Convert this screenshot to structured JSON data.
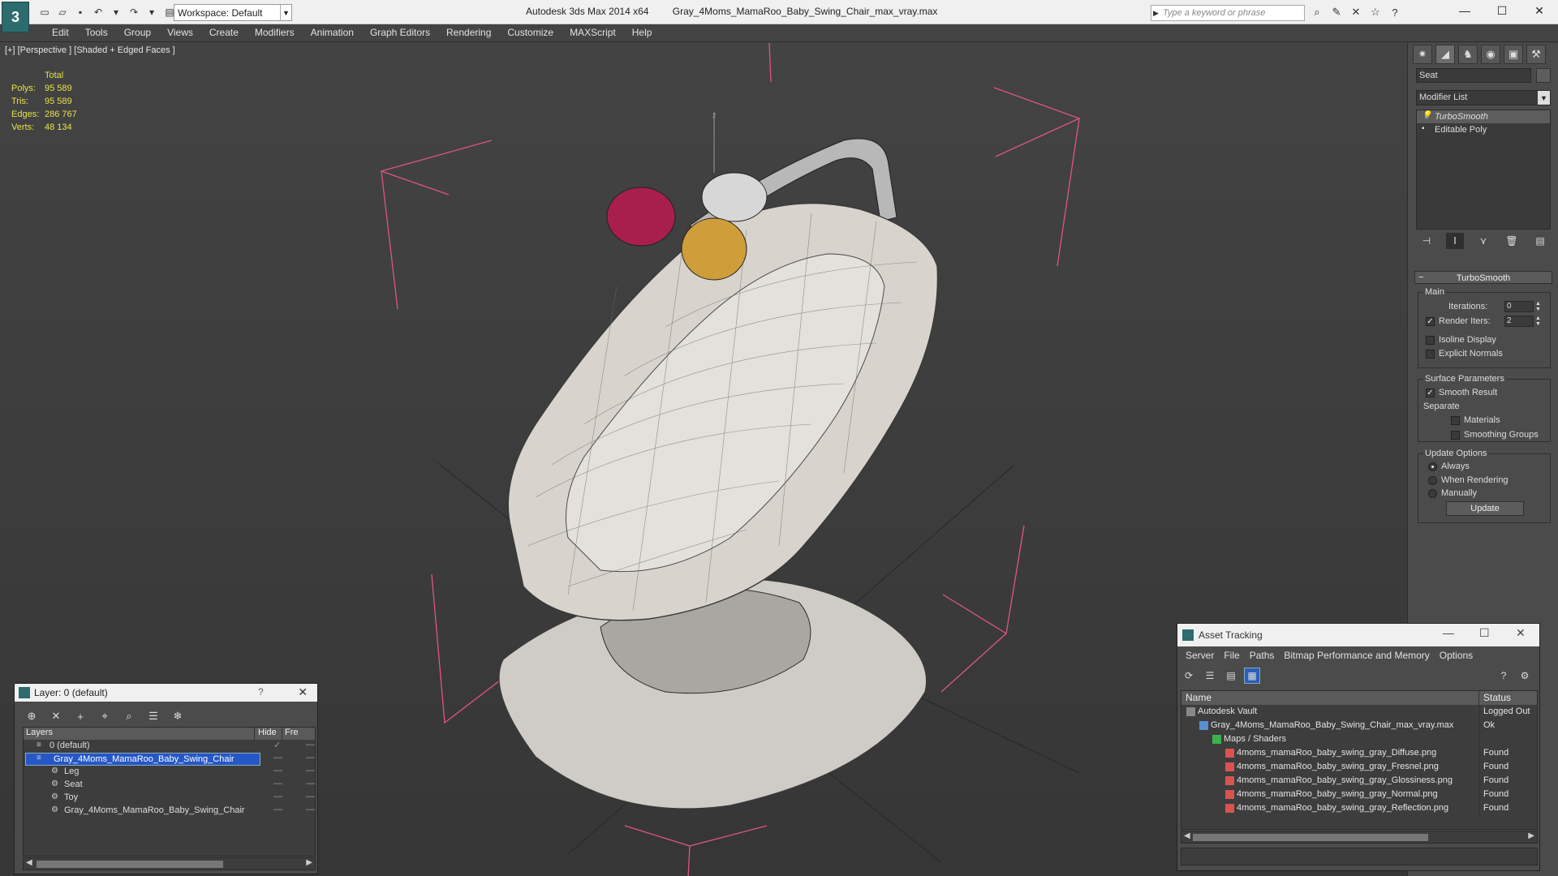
{
  "app": {
    "name": "Autodesk 3ds Max",
    "version": "2014 x64",
    "file": "Gray_4Moms_MamaRoo_Baby_Swing_Chair_max_vray.max",
    "logo_glyph": "3"
  },
  "workspace": {
    "label": "Workspace: Default"
  },
  "search": {
    "placeholder": "Type a keyword or phrase"
  },
  "menu": [
    "Edit",
    "Tools",
    "Group",
    "Views",
    "Create",
    "Modifiers",
    "Animation",
    "Graph Editors",
    "Rendering",
    "Customize",
    "MAXScript",
    "Help"
  ],
  "viewport": {
    "label": "[+] [Perspective ] [Shaded + Edged Faces ]",
    "stats_header": "Total",
    "stats": [
      {
        "key": "Polys:",
        "value": "95 589"
      },
      {
        "key": "Tris:",
        "value": "95 589"
      },
      {
        "key": "Edges:",
        "value": "286 767"
      },
      {
        "key": "Verts:",
        "value": "48 134"
      }
    ],
    "axis_label": "z"
  },
  "command_panel": {
    "object_name": "Seat",
    "modifier_list": "Modifier List",
    "stack": [
      "TurboSmooth",
      "Editable Poly"
    ],
    "rollout_title": "TurboSmooth",
    "main_group": "Main",
    "iterations_label": "Iterations:",
    "iterations_value": "0",
    "render_iters_label": "Render Iters:",
    "render_iters_value": "2",
    "render_iters_checked": true,
    "isoline_display": "Isoline Display",
    "explicit_normals": "Explicit Normals",
    "surface_group": "Surface Parameters",
    "smooth_result": "Smooth Result",
    "separate_label": "Separate",
    "materials": "Materials",
    "smoothing_groups": "Smoothing Groups",
    "update_group": "Update Options",
    "always": "Always",
    "when_rendering": "When Rendering",
    "manually": "Manually",
    "update_button": "Update"
  },
  "layer_dialog": {
    "title": "Layer: 0 (default)",
    "help": "?",
    "col_layers": "Layers",
    "col_hide": "Hide",
    "col_freeze": "Fre",
    "rows": [
      {
        "name": "0 (default)",
        "indent": 1
      },
      {
        "name": "Gray_4Moms_MamaRoo_Baby_Swing_Chair",
        "indent": 1
      },
      {
        "name": "Leg",
        "indent": 2
      },
      {
        "name": "Seat",
        "indent": 2
      },
      {
        "name": "Toy",
        "indent": 2
      },
      {
        "name": "Gray_4Moms_MamaRoo_Baby_Swing_Chair",
        "indent": 2
      }
    ]
  },
  "asset_tracking": {
    "title": "Asset Tracking",
    "menu": [
      "Server",
      "File",
      "Paths",
      "Bitmap Performance and Memory",
      "Options"
    ],
    "col_name": "Name",
    "col_status": "Status",
    "rows": [
      {
        "name": "Autodesk Vault",
        "status": "Logged Out"
      },
      {
        "name": "Gray_4Moms_MamaRoo_Baby_Swing_Chair_max_vray.max",
        "status": "Ok"
      },
      {
        "name": "Maps / Shaders",
        "status": ""
      },
      {
        "name": "4moms_mamaRoo_baby_swing_gray_Diffuse.png",
        "status": "Found"
      },
      {
        "name": "4moms_mamaRoo_baby_swing_gray_Fresnel.png",
        "status": "Found"
      },
      {
        "name": "4moms_mamaRoo_baby_swing_gray_Glossiness.png",
        "status": "Found"
      },
      {
        "name": "4moms_mamaRoo_baby_swing_gray_Normal.png",
        "status": "Found"
      },
      {
        "name": "4moms_mamaRoo_baby_swing_gray_Reflection.png",
        "status": "Found"
      }
    ]
  },
  "colors": {
    "viewport_bg": "#3c3c3c",
    "stats_text": "#e7e24c",
    "selection_blue": "#2557c7",
    "bounding_box": "#e0557f"
  }
}
